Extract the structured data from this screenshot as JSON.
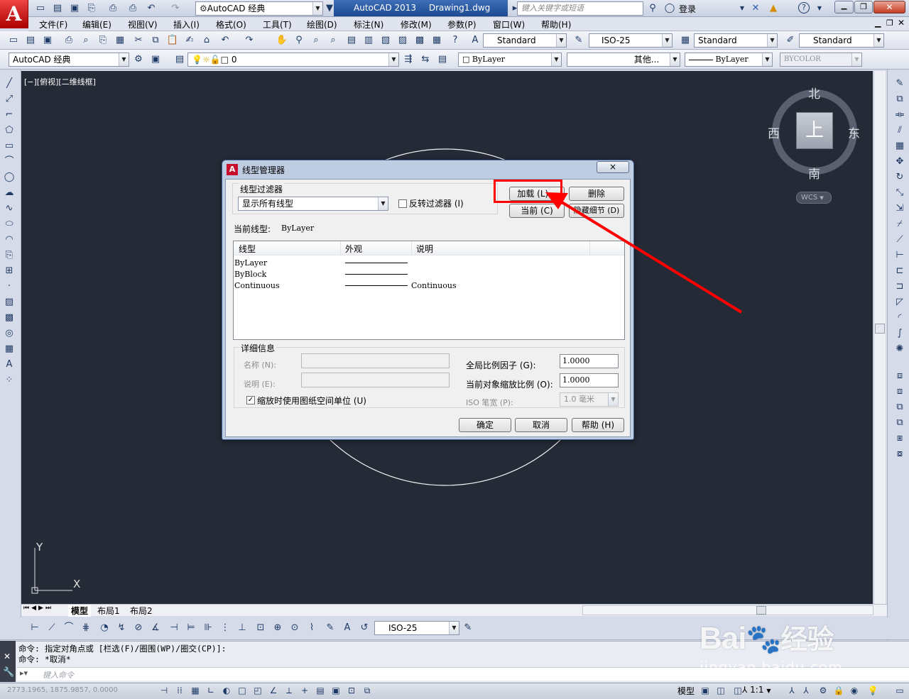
{
  "app": {
    "name": "AutoCAD 2013",
    "drawing": "Drawing1.dwg",
    "logo_letter": "A",
    "workspace": "AutoCAD 经典",
    "search_placeholder": "键入关键字或短语",
    "login": "登录"
  },
  "menubar": [
    "文件(F)",
    "编辑(E)",
    "视图(V)",
    "插入(I)",
    "格式(O)",
    "工具(T)",
    "绘图(D)",
    "标注(N)",
    "修改(M)",
    "参数(P)",
    "窗口(W)",
    "帮助(H)"
  ],
  "styles": {
    "text_style": "Standard",
    "dim_style": "ISO-25",
    "table_style": "Standard",
    "mleader_style": "Standard"
  },
  "layers": {
    "workspace": "AutoCAD 经典",
    "current_layer": "0",
    "color": "ByLayer",
    "linetype": "其他...",
    "lineweight": "ByLayer",
    "plotstyle": "BYCOLOR"
  },
  "viewport": {
    "label": "[−][俯视][二维线框]",
    "viewcube": {
      "north": "北",
      "south": "南",
      "east": "东",
      "west": "西",
      "top": "上",
      "wcs": "WCS"
    },
    "ucs_x": "X",
    "ucs_y": "Y"
  },
  "tabs": [
    "模型",
    "布局1",
    "布局2"
  ],
  "dimtoolbar": {
    "dim_style": "ISO-25"
  },
  "command": {
    "lines": [
      "命令: 指定对角点或 [栏选(F)/圈围(WP)/圈交(CP)]:",
      "命令: *取消*"
    ],
    "placeholder": "键入命令"
  },
  "statusbar": {
    "coords": "2773.1965, 1875.9857, 0.0000",
    "model": "模型",
    "scale": "1:1"
  },
  "dialog": {
    "title": "线型管理器",
    "close": "×",
    "filter_label": "线型过滤器",
    "filter_value": "显示所有线型",
    "invert_label": "反转过滤器 (I)",
    "btn_load": "加载 (L)...",
    "btn_delete": "删除",
    "btn_current": "当前 (C)",
    "btn_details": "隐藏细节 (D)",
    "current_linetype_label": "当前线型:",
    "current_linetype_value": "ByLayer",
    "columns": [
      "线型",
      "外观",
      "说明"
    ],
    "rows": [
      {
        "name": "ByLayer",
        "desc": ""
      },
      {
        "name": "ByBlock",
        "desc": ""
      },
      {
        "name": "Continuous",
        "desc": "Continuous"
      }
    ],
    "details_label": "详细信息",
    "name_label": "名称 (N):",
    "desc_label": "说明 (E):",
    "global_scale_label": "全局比例因子 (G):",
    "global_scale": "1.0000",
    "obj_scale_label": "当前对象缩放比例 (O):",
    "obj_scale": "1.0000",
    "iso_label": "ISO 笔宽 (P):",
    "iso_value": "1.0 毫米",
    "paper_units_label": "缩放时使用图纸空间单位 (U)",
    "ok": "确定",
    "cancel": "取消",
    "help": "帮助 (H)"
  },
  "watermark": {
    "brand": "Bai",
    "brand2": "经验",
    "url": "jingyan.baidu.com"
  },
  "colors": {
    "canvas": "#252a37",
    "highlight": "#ff0000",
    "accent": "#c8102e"
  }
}
